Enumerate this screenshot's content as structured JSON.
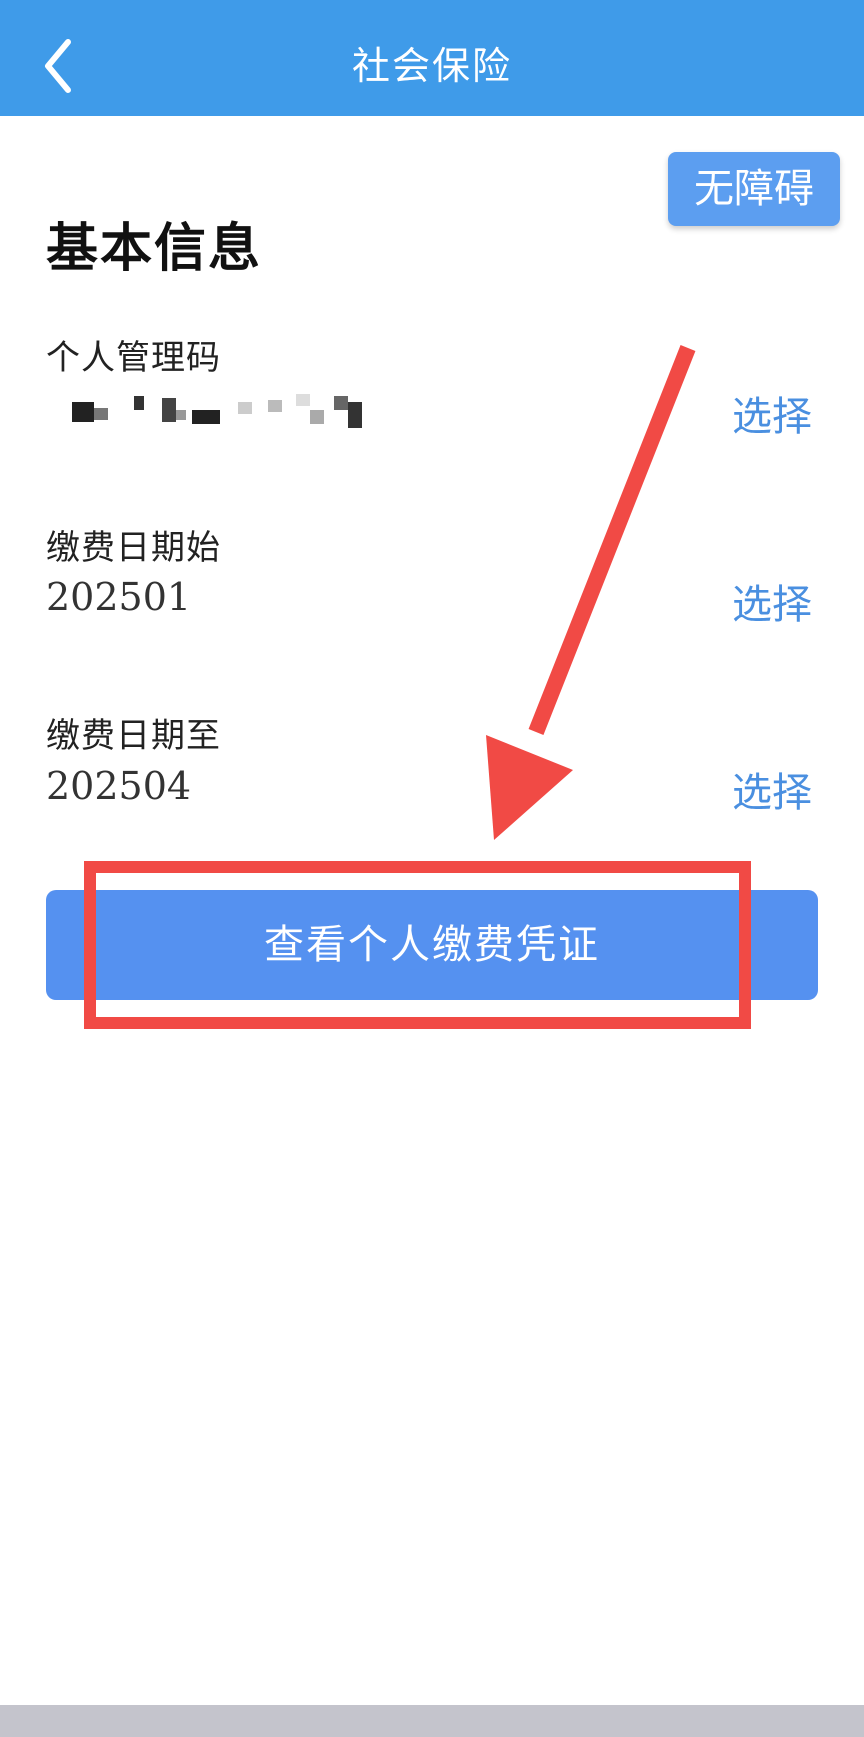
{
  "header": {
    "title": "社会保险"
  },
  "accessibility_button": {
    "label": "无障碍"
  },
  "section": {
    "title": "基本信息"
  },
  "fields": [
    {
      "label": "个人管理码",
      "value": "",
      "action": "选择"
    },
    {
      "label": "缴费日期始",
      "value": "202501",
      "action": "选择"
    },
    {
      "label": "缴费日期至",
      "value": "202504",
      "action": "选择"
    }
  ],
  "primary_button": {
    "label": "查看个人缴费凭证"
  },
  "colors": {
    "header_bg": "#3f9be9",
    "link": "#4a8fe0",
    "button_bg": "#5591f0",
    "annotation": "#f14a45"
  },
  "icons": {
    "back": "chevron-left-icon"
  }
}
